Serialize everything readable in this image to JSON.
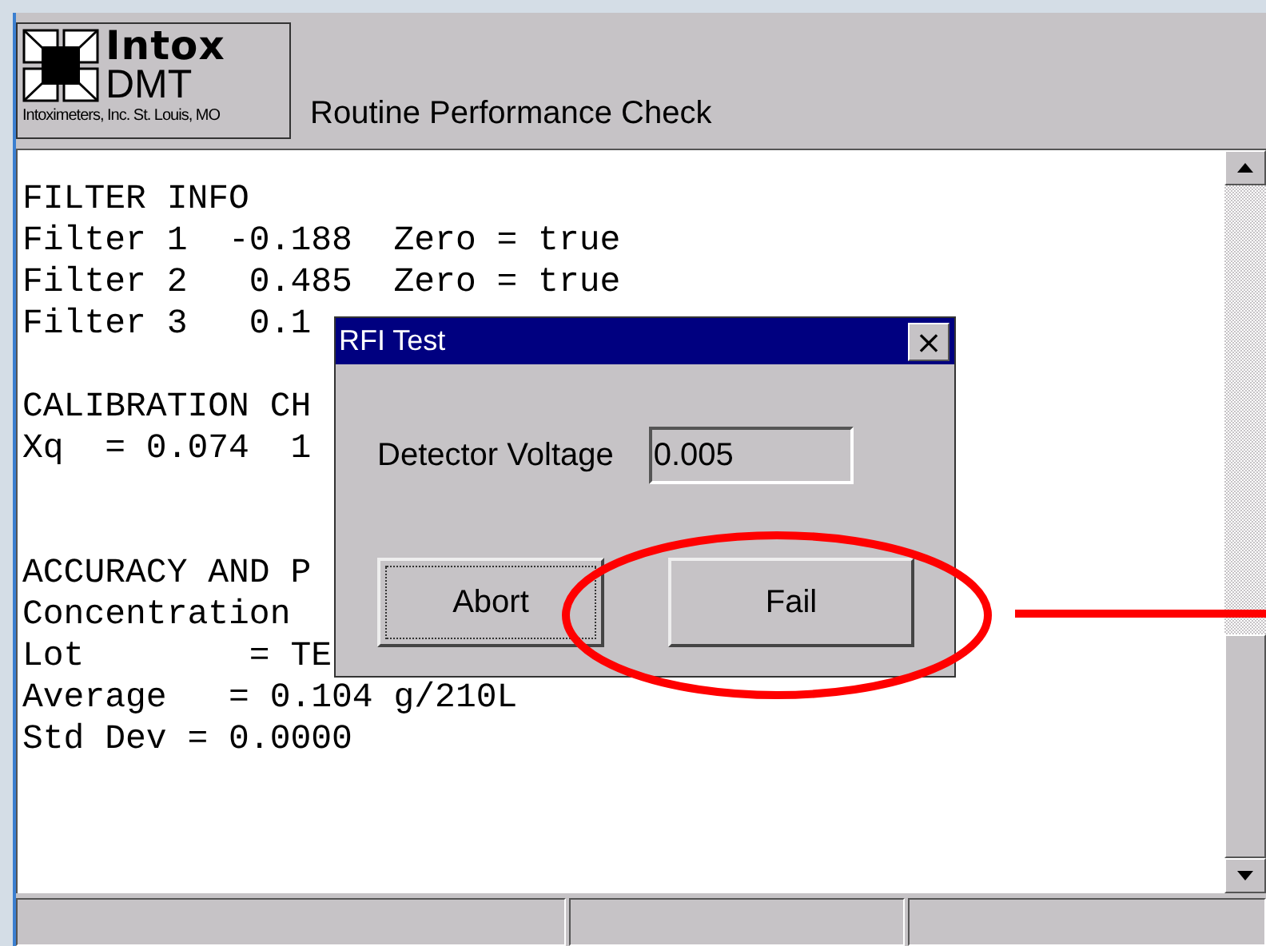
{
  "logo": {
    "brand": "Intox",
    "model": "DMT",
    "company": "Intoximeters, Inc. St. Louis, MO"
  },
  "title": "Routine Performance Check",
  "report_lines": [
    {
      "kind": "text",
      "text": "FILTER INFO"
    },
    {
      "kind": "text",
      "text": "Filter 1  -0.188  Zero = true"
    },
    {
      "kind": "text",
      "text": "Filter 2   0.485  Zero = true"
    },
    {
      "kind": "text",
      "text": "Filter 3   0.1"
    },
    {
      "kind": "blank"
    },
    {
      "kind": "text",
      "text": "CALIBRATION CH"
    },
    {
      "kind": "text",
      "text": "Xq  = 0.074  1"
    },
    {
      "kind": "blank"
    },
    {
      "kind": "blank"
    },
    {
      "kind": "text",
      "text": "ACCURACY AND P"
    },
    {
      "kind": "text",
      "text": "Concentration"
    },
    {
      "kind": "text",
      "text": "Lot        = TE"
    },
    {
      "kind": "text",
      "text": "Average   = 0.104 g/210L"
    },
    {
      "kind": "text",
      "text": "Std Dev = 0.0000"
    }
  ],
  "dialog": {
    "title": "RFI Test",
    "close": "×",
    "field_label": "Detector Voltage",
    "field_value": "0.005",
    "buttons": [
      {
        "label": "Abort",
        "focused": true
      },
      {
        "label": "Fail",
        "focused": false
      }
    ]
  },
  "annotation": {
    "circled": true
  }
}
